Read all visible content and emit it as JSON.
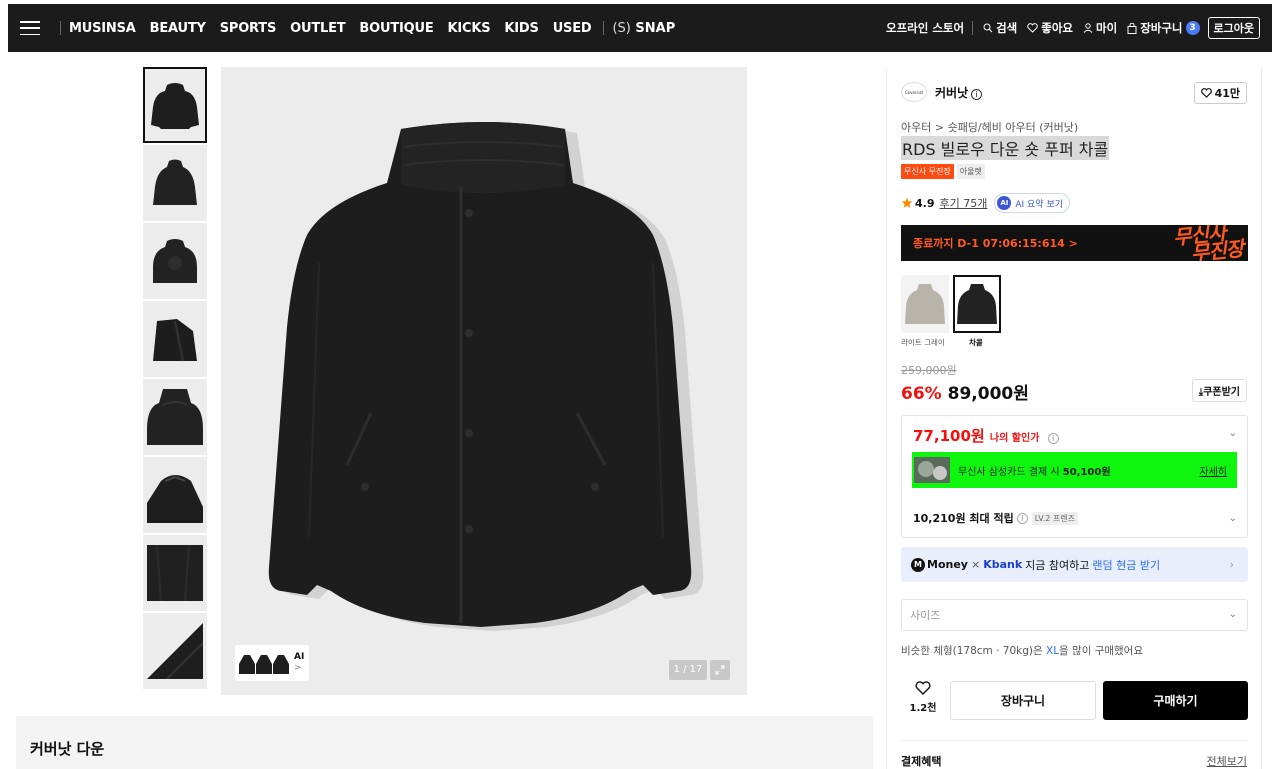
{
  "nav": {
    "items": [
      "MUSINSA",
      "BEAUTY",
      "SPORTS",
      "OUTLET",
      "BOUTIQUE",
      "KICKS",
      "KIDS",
      "USED"
    ],
    "snap_prefix": "(S)",
    "snap_label": "SNAP",
    "offline_store": "오프라인 스토어",
    "search": "검색",
    "likes": "좋아요",
    "my": "마이",
    "cart": "장바구니",
    "cart_count": "3",
    "logout": "로그아웃"
  },
  "gallery": {
    "ai_label": "AI",
    "ai_arrow": ">",
    "counter": "1 / 17"
  },
  "section": {
    "brand_title": "커버낫 다운"
  },
  "product": {
    "brand_logo_text": "Covernat",
    "brand": "커버낫",
    "info_icon": "i",
    "likes": "41만",
    "breadcrumb": "아우터 > 숏패딩/헤비 아우터 (커버낫)",
    "title": "RDS 빌로우 다운 숏 푸퍼 차콜",
    "badge_event": "무신사 무진장",
    "badge_outlet": "아울렛",
    "rating": "4.9",
    "review_count": "후기 75개",
    "ai_summary_icon": "AI",
    "ai_summary": "AI 요약 보기",
    "timer": "종료까지 D-1 07:06:15:614 >",
    "timer_logo_1": "무신사",
    "timer_logo_2": "무진장",
    "colors": [
      {
        "label": "라이트 그레이",
        "hex": "#b8b4aa"
      },
      {
        "label": "차콜",
        "hex": "#222222"
      }
    ],
    "original_price": "259,000원",
    "discount_pct": "66%",
    "sale_price": "89,000원",
    "coupon": "쿠폰받기",
    "my_price": "77,100원",
    "my_price_label": "나의 할인가",
    "card_text": "무신사 삼성카드 결제 시",
    "card_price": "50,100원",
    "card_more": "자세히",
    "points": "10,210원 최대 적립",
    "level": "LV.2 프렌즈",
    "money_icon": "M",
    "money_text": "Money",
    "money_x": "×",
    "kbank": "Kbank",
    "money_join": "지금 참여하고",
    "money_highlight": "랜덤 현금 받기",
    "size_placeholder": "사이즈",
    "similar_prefix": "비슷한 체형(178cm · 70kg)은",
    "similar_size": "XL",
    "similar_suffix": "을 많이 구매했어요",
    "wish_count": "1.2천",
    "cart_button": "장바구니",
    "buy_button": "구매하기",
    "payment_benefits": "결제혜택",
    "see_all": "전체보기"
  },
  "colors": {
    "nav_bg": "#1b1b1b",
    "accent_red": "#f31110",
    "event_orange": "#ff5a1f",
    "card_green": "#0ef50e",
    "link_blue": "#2b6ef0"
  }
}
